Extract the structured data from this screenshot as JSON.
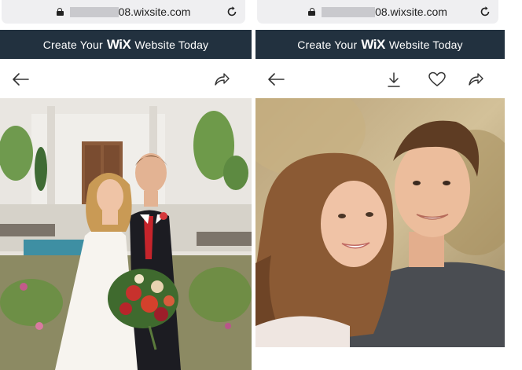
{
  "screens": [
    {
      "url": {
        "domain": "08.wixsite.com"
      },
      "banner": {
        "prefix": "Create Your",
        "brand": "WiX",
        "suffix": "Website Today"
      },
      "toolbar": {
        "icons": [
          "back-arrow-icon",
          "share-icon"
        ]
      },
      "photo": {
        "subject": "wedding-couple-full-length"
      }
    },
    {
      "url": {
        "domain": "08.wixsite.com"
      },
      "banner": {
        "prefix": "Create Your",
        "brand": "WiX",
        "suffix": "Website Today"
      },
      "toolbar": {
        "icons": [
          "back-arrow-icon",
          "download-icon",
          "heart-icon",
          "share-icon"
        ]
      },
      "photo": {
        "subject": "couple-close-up-selfie"
      }
    }
  ],
  "colors": {
    "banner_bg": "#22313f",
    "urlbar_bg": "#efeff1",
    "redaction": "#c9c9cd"
  }
}
